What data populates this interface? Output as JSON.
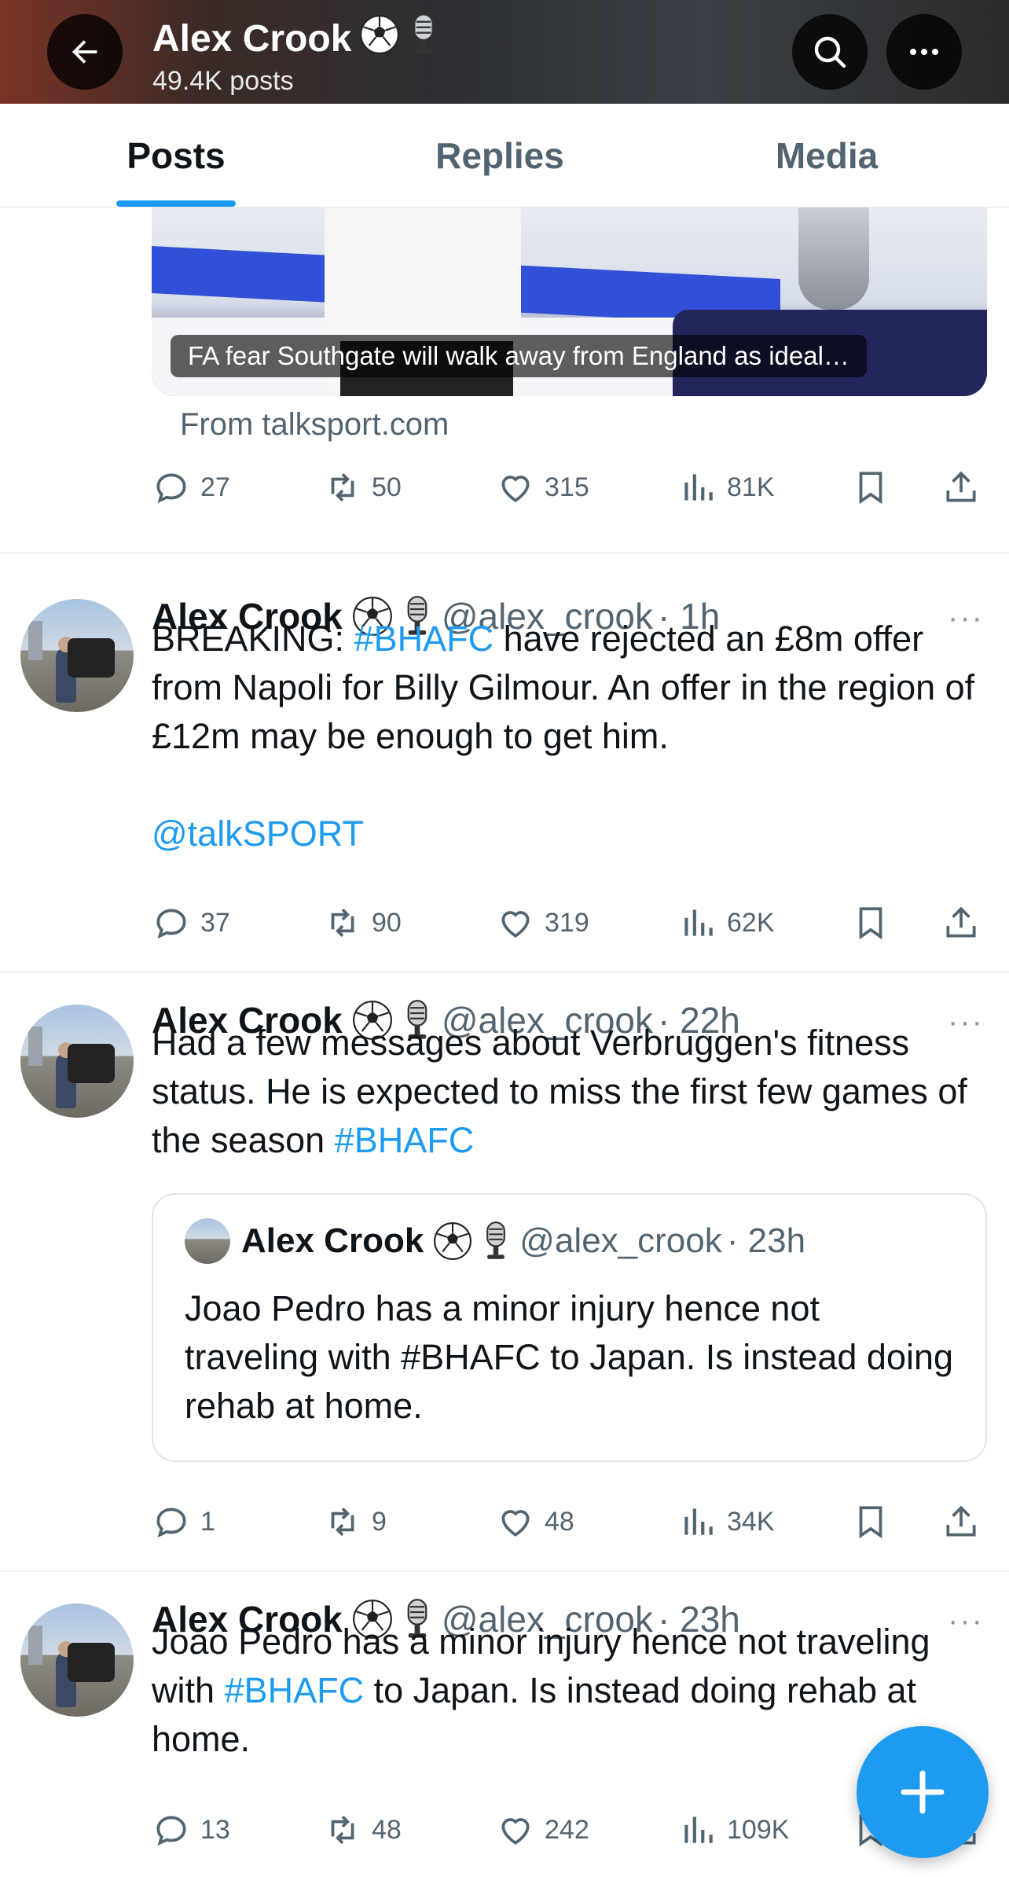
{
  "header": {
    "name": "Alex Crook",
    "posts_count": "49.4K posts",
    "icons": [
      "soccer-ball-icon",
      "microphone-icon"
    ]
  },
  "tabs": [
    {
      "label": "Posts",
      "active": true
    },
    {
      "label": "Replies",
      "active": false
    },
    {
      "label": "Media",
      "active": false
    }
  ],
  "top_card": {
    "caption": "FA fear Southgate will walk away from England as ideal…",
    "source": "From talksport.com",
    "replies": "27",
    "reposts": "50",
    "likes": "315",
    "views": "81K"
  },
  "tweets": [
    {
      "name": "Alex Crook",
      "handle": "@alex_crook",
      "time": "· 1h",
      "body": [
        {
          "text": "BREAKING: "
        },
        {
          "text": "#BHAFC",
          "link": true
        },
        {
          "text": " have rejected an £8m offer from Napoli for Billy Gilmour. An offer in the region of £12m may be enough to get him."
        }
      ],
      "mention": "@talkSPORT",
      "replies": "37",
      "reposts": "90",
      "likes": "319",
      "views": "62K"
    },
    {
      "name": "Alex Crook",
      "handle": "@alex_crook",
      "time": "· 22h",
      "body_before": "Had a few messages about Verbruggen's fitness status. He is expected to miss the first few games of the season ",
      "body_tag": "#BHAFC",
      "quote": {
        "name": "Alex Crook",
        "handle": "@alex_crook",
        "time": "· 23h",
        "body": "Joao Pedro has a minor injury hence not traveling with #BHAFC to Japan. Is instead doing rehab at home."
      },
      "replies": "1",
      "reposts": "9",
      "likes": "48",
      "views": "34K"
    },
    {
      "name": "Alex Crook",
      "handle": "@alex_crook",
      "time": "· 23h",
      "body_before": "Joao Pedro has a minor injury hence not traveling with ",
      "body_tag": "#BHAFC",
      "body_after": " to Japan. Is instead doing rehab at home.",
      "replies": "13",
      "reposts": "48",
      "likes": "242",
      "views": "109K"
    }
  ],
  "more_label": "···",
  "colors": {
    "accent": "#1d9bf0",
    "text_primary": "#0f1419",
    "text_secondary": "#536471"
  }
}
